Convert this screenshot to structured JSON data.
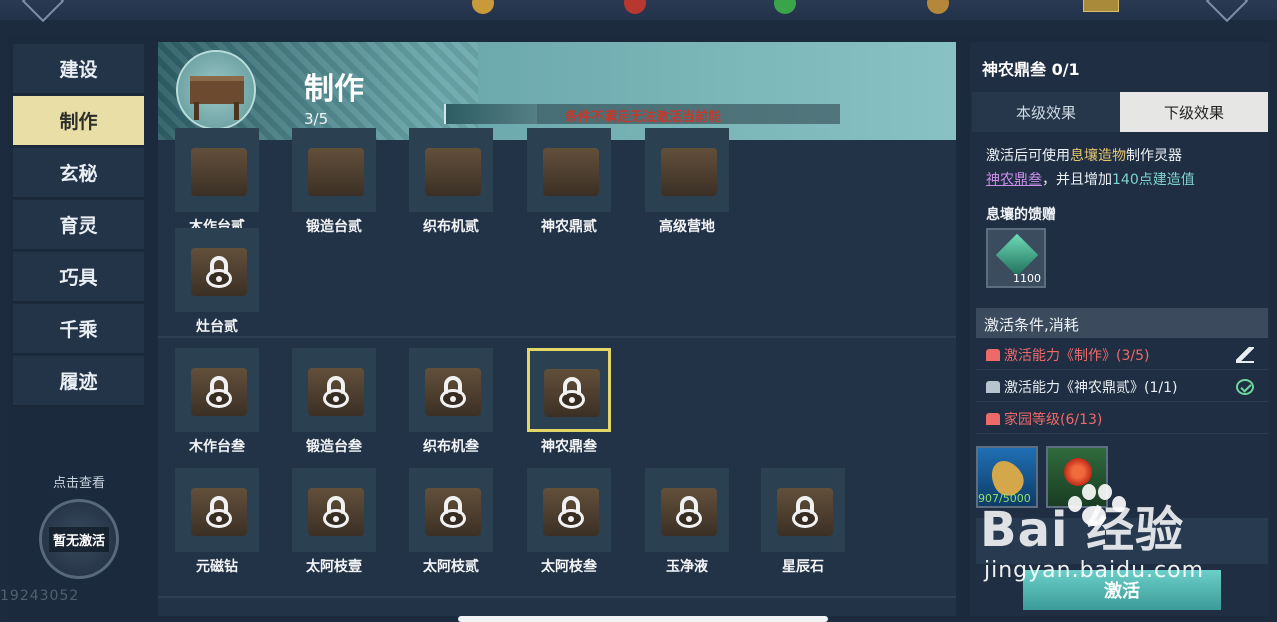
{
  "nav": {
    "items": [
      {
        "label": "建设"
      },
      {
        "label": "制作"
      },
      {
        "label": "玄秘"
      },
      {
        "label": "育灵"
      },
      {
        "label": "巧具"
      },
      {
        "label": "千乘"
      },
      {
        "label": "履迹"
      }
    ],
    "active_index": 1
  },
  "side_badge": {
    "hint": "点击查看",
    "status": "暂无激活"
  },
  "uid": "19243052",
  "header": {
    "title": "制作",
    "count": "3/5",
    "progress_text": "条件不满足无法激活当前能",
    "progress_fraction": 0.23
  },
  "grid": {
    "rows": [
      {
        "items": [
          {
            "label": "木作台贰",
            "locked": false
          },
          {
            "label": "锻造台贰",
            "locked": false
          },
          {
            "label": "织布机贰",
            "locked": false
          },
          {
            "label": "神农鼎贰",
            "locked": false
          },
          {
            "label": "高级营地",
            "locked": false
          }
        ]
      },
      {
        "items": [
          {
            "label": "灶台贰",
            "locked": true
          }
        ]
      },
      {
        "items": [
          {
            "label": "木作台叁",
            "locked": true
          },
          {
            "label": "锻造台叁",
            "locked": true
          },
          {
            "label": "织布机叁",
            "locked": true
          },
          {
            "label": "神农鼎叁",
            "locked": true,
            "selected": true
          }
        ]
      },
      {
        "items": [
          {
            "label": "元磁钻",
            "locked": true
          },
          {
            "label": "太阿枝壹",
            "locked": true
          },
          {
            "label": "太阿枝贰",
            "locked": true
          },
          {
            "label": "太阿枝叁",
            "locked": true
          },
          {
            "label": "玉净液",
            "locked": true
          },
          {
            "label": "星辰石",
            "locked": true
          }
        ]
      }
    ]
  },
  "detail": {
    "title": "神农鼎叁 0/1",
    "tabs": [
      {
        "label": "本级效果"
      },
      {
        "label": "下级效果"
      }
    ],
    "active_tab": 1,
    "desc": {
      "p1": "激活后可使用",
      "gold": "息壤造物",
      "p2": "制作灵器",
      "purple": "神农鼎叁",
      "p3": "，并且增加",
      "teal": "140点建造值"
    },
    "gift_title": "息壤的馈赠",
    "gift_qty": "1100",
    "conditions_header": "激活条件,消耗",
    "conditions": [
      {
        "text": "激活能力《制作》(3/5)",
        "met": false
      },
      {
        "text": "激活能力《神农鼎贰》(1/1)",
        "met": true
      },
      {
        "text": "家园等级(6/13)",
        "met": false
      }
    ],
    "material_qty": "907/5000",
    "activate_label": "激活"
  },
  "watermark": {
    "brand": "Bai 经验",
    "site": "jingyan.baidu.com"
  }
}
